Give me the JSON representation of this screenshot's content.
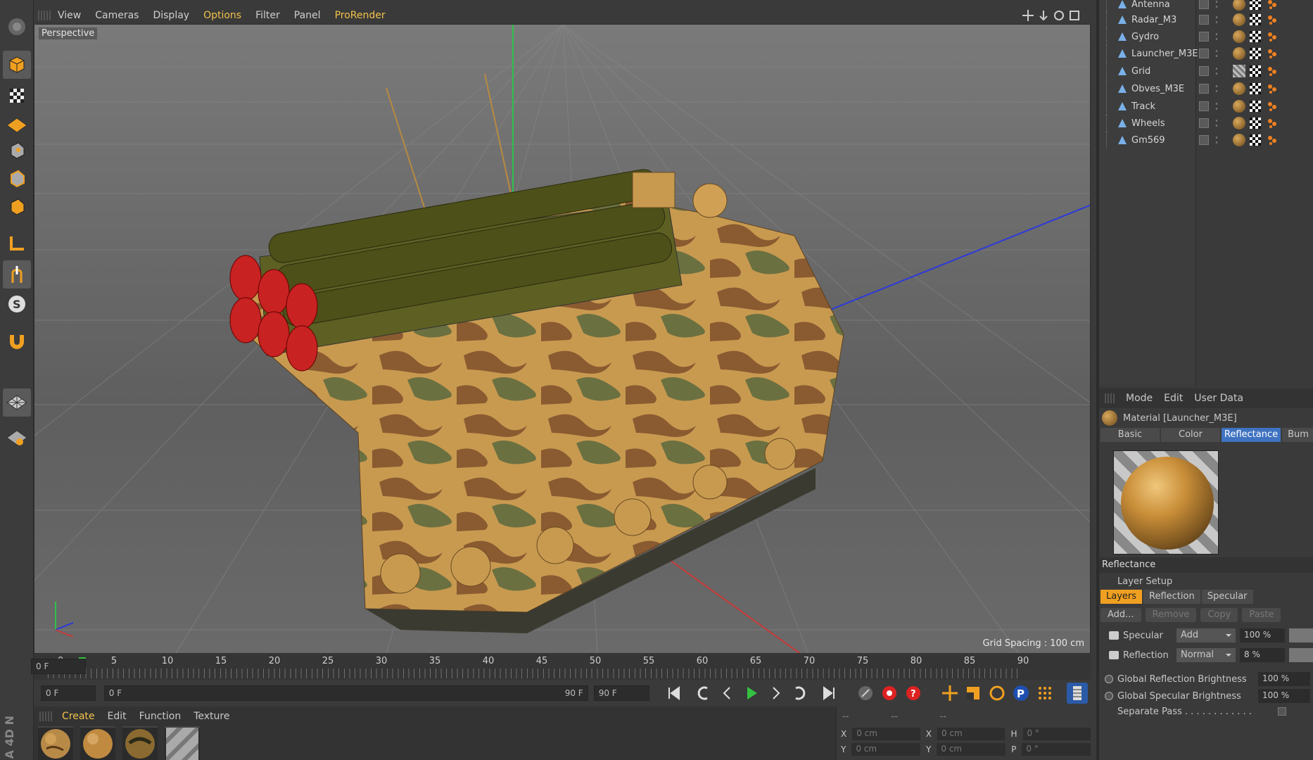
{
  "viewport": {
    "menu": [
      "View",
      "Cameras",
      "Display",
      "Options",
      "Filter",
      "Panel",
      "ProRender"
    ],
    "label": "Perspective",
    "grid_spacing": "Grid Spacing : 100 cm"
  },
  "timeline": {
    "ticks": [
      "0",
      "5",
      "10",
      "15",
      "20",
      "25",
      "30",
      "35",
      "40",
      "45",
      "50",
      "55",
      "60",
      "65",
      "70",
      "75",
      "80",
      "85",
      "90"
    ],
    "end_field": "0 F"
  },
  "transport": {
    "start_field": "0 F",
    "range_start": "0 F",
    "range_end": "90 F",
    "end_field": "90 F"
  },
  "material_manager": {
    "menu": [
      "Create",
      "Edit",
      "Function",
      "Texture"
    ]
  },
  "coordinates": {
    "header": [
      "--",
      "--",
      "--"
    ],
    "rows": [
      {
        "l1": "X",
        "v1": "0 cm",
        "l2": "X",
        "v2": "0 cm",
        "l3": "H",
        "v3": "0 °"
      },
      {
        "l1": "Y",
        "v1": "0 cm",
        "l2": "Y",
        "v2": "0 cm",
        "l3": "P",
        "v3": "0 °"
      }
    ]
  },
  "objects": [
    "Antenna",
    "Radar_M3",
    "Gydro",
    "Launcher_M3E",
    "Grid",
    "Obves_M3E",
    "Track",
    "Wheels",
    "Gm569"
  ],
  "attributes": {
    "menu": [
      "Mode",
      "Edit",
      "User Data"
    ],
    "title": "Material [Launcher_M3E]",
    "tabs": [
      "Basic",
      "Color",
      "Reflectance",
      "Bum"
    ],
    "section": "Reflectance",
    "layer_setup": "Layer Setup",
    "layer_tabs": [
      "Layers",
      "Reflection",
      "Specular"
    ],
    "buttons": [
      "Add...",
      "Remove",
      "Copy",
      "Paste"
    ],
    "layers": [
      {
        "name": "Specular",
        "mode": "Add",
        "value": "100 %"
      },
      {
        "name": "Reflection",
        "mode": "Normal",
        "value": "8 %"
      }
    ],
    "global_reflection_label": "Global Reflection Brightness",
    "global_reflection_value": "100 %",
    "global_specular_label": "Global Specular Brightness",
    "global_specular_value": "100 %",
    "separate_pass": "Separate Pass . . . . . . . . . . . ."
  },
  "brand": "A 4D N",
  "colors": {
    "accent": "#f2c24a",
    "active_tab": "#3f73c1",
    "layer_tab": "#f0a020"
  }
}
